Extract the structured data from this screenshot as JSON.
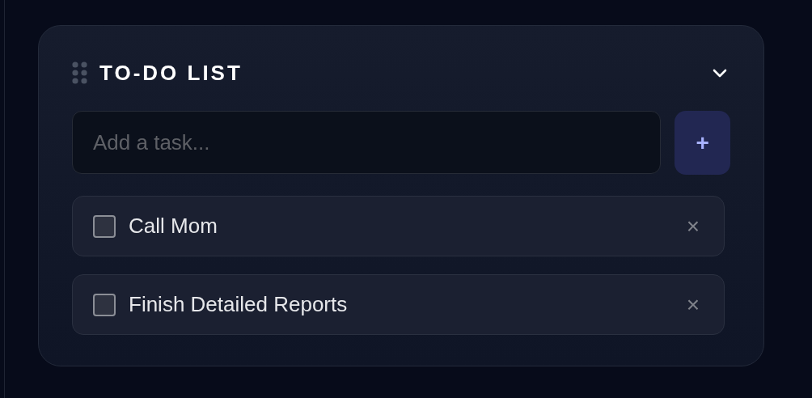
{
  "widget": {
    "title": "TO-DO LIST"
  },
  "new_task": {
    "placeholder": "Add a task...",
    "add_label": "+"
  },
  "tasks": [
    {
      "text": "Call Mom",
      "checked": false,
      "delete_label": "×"
    },
    {
      "text": "Finish Detailed Reports",
      "checked": false,
      "delete_label": "×"
    }
  ]
}
